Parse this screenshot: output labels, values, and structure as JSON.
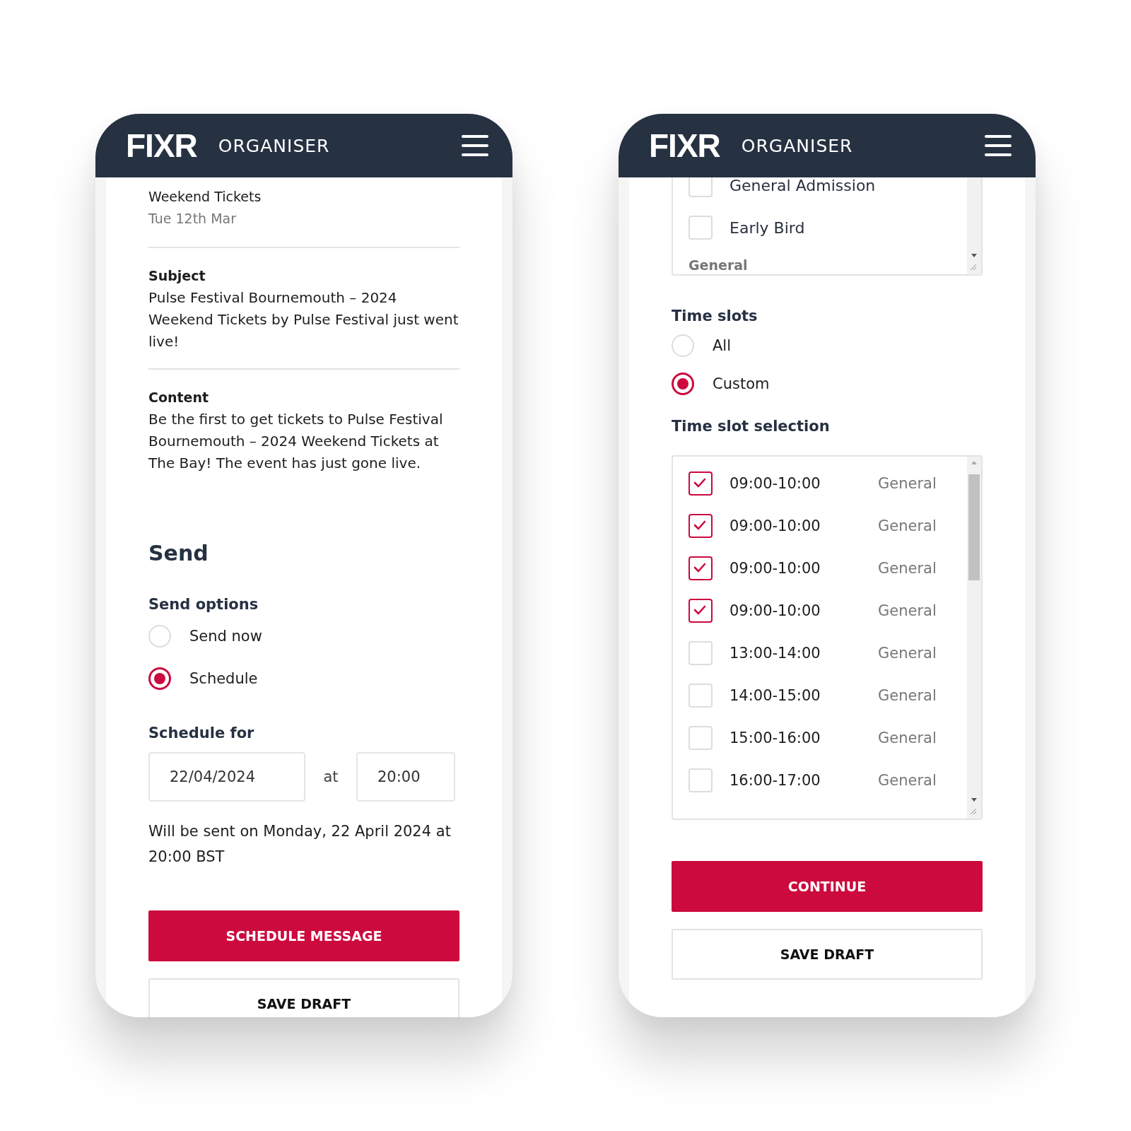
{
  "screens": [
    {
      "header": {
        "logo": "FIXR",
        "title": "ORGANISER"
      },
      "sections": [
        {
          "kind": "event",
          "title": "Weekend Tickets",
          "date": "Tue 12th Mar"
        },
        {
          "kind": "field",
          "label": "Subject",
          "text": "Pulse Festival Bournemouth – 2024 Weekend Tickets by Pulse Festival just went live!"
        },
        {
          "kind": "field",
          "label": "Content",
          "text": "Be the first to get tickets to Pulse Festival Bournemouth – 2024 Weekend Tickets at The Bay! The event has just gone live."
        },
        {
          "kind": "heading",
          "text": "Send"
        },
        {
          "kind": "radio_group",
          "label": "Send options",
          "options": [
            {
              "label": "Send now",
              "selected": false
            },
            {
              "label": "Schedule",
              "selected": true
            }
          ]
        },
        {
          "kind": "schedule",
          "label": "Schedule for",
          "date": "22/04/2024",
          "connector": "at",
          "time": "20:00",
          "note": "Will be sent on Monday, 22 April 2024 at 20:00 BST"
        },
        {
          "kind": "primary_button",
          "label": "SCHEDULE MESSAGE"
        },
        {
          "kind": "secondary_button",
          "label": "SAVE DRAFT"
        }
      ]
    },
    {
      "header": {
        "logo": "FIXR",
        "title": "ORGANISER"
      },
      "sections": [
        {
          "kind": "checklist",
          "items": [
            {
              "label": "General Admission",
              "checked": false
            },
            {
              "label": "Early Bird",
              "checked": false
            }
          ],
          "group_label": "General"
        },
        {
          "kind": "radio_group",
          "label": "Time slots",
          "options": [
            {
              "label": "All",
              "selected": false
            },
            {
              "label": "Custom",
              "selected": true
            }
          ]
        },
        {
          "kind": "slot_list",
          "label": "Time slot selection",
          "items": [
            {
              "time": "09:00-10:00",
              "type": "General",
              "checked": true
            },
            {
              "time": "09:00-10:00",
              "type": "General",
              "checked": true
            },
            {
              "time": "09:00-10:00",
              "type": "General",
              "checked": true
            },
            {
              "time": "09:00-10:00",
              "type": "General",
              "checked": true
            },
            {
              "time": "13:00-14:00",
              "type": "General",
              "checked": false
            },
            {
              "time": "14:00-15:00",
              "type": "General",
              "checked": false
            },
            {
              "time": "15:00-16:00",
              "type": "General",
              "checked": false
            },
            {
              "time": "16:00-17:00",
              "type": "General",
              "checked": false
            }
          ]
        },
        {
          "kind": "primary_button",
          "label": "CONTINUE"
        },
        {
          "kind": "secondary_button",
          "label": "SAVE DRAFT"
        }
      ]
    }
  ]
}
